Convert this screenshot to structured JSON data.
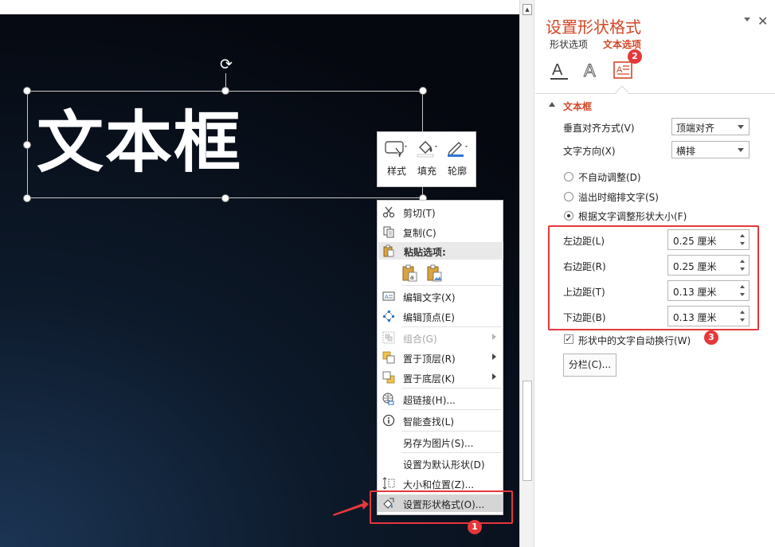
{
  "slide": {
    "textbox_text": "文本框"
  },
  "mini_toolbar": {
    "style_label": "样式",
    "fill_label": "填充",
    "outline_label": "轮廓"
  },
  "context_menu": {
    "cut": "剪切(T)",
    "copy": "复制(C)",
    "paste_options": "粘贴选项:",
    "edit_text": "编辑文字(X)",
    "edit_points": "编辑顶点(E)",
    "group": "组合(G)",
    "bring_to_front": "置于顶层(R)",
    "send_to_back": "置于底层(K)",
    "hyperlink": "超链接(H)...",
    "smart_lookup": "智能查找(L)",
    "save_as_picture": "另存为图片(S)...",
    "set_default_shape": "设置为默认形状(D)",
    "size_position": "大小和位置(Z)...",
    "format_shape": "设置形状格式(O)..."
  },
  "pane": {
    "title": "设置形状格式",
    "tab_shape_options": "形状选项",
    "tab_text_options": "文本选项",
    "section_title": "文本框",
    "vertical_align_label": "垂直对齐方式(V)",
    "vertical_align_value": "顶端对齐",
    "text_direction_label": "文字方向(X)",
    "text_direction_value": "横排",
    "autofit_options": [
      {
        "label": "不自动调整(D)",
        "selected": false
      },
      {
        "label": "溢出时缩排文字(S)",
        "selected": false
      },
      {
        "label": "根据文字调整形状大小(F)",
        "selected": true
      }
    ],
    "margins": [
      {
        "label": "左边距(L)",
        "value": "0.25 厘米"
      },
      {
        "label": "右边距(R)",
        "value": "0.25 厘米"
      },
      {
        "label": "上边距(T)",
        "value": "0.13 厘米"
      },
      {
        "label": "下边距(B)",
        "value": "0.13 厘米"
      }
    ],
    "wrap_text_label": "形状中的文字自动换行(W)",
    "wrap_text_checked": true,
    "columns_button": "分栏(C)..."
  },
  "badges": {
    "one": "1",
    "two": "2",
    "three": "3"
  },
  "colors": {
    "accent": "#d24726",
    "highlight_red": "#e5383b"
  }
}
